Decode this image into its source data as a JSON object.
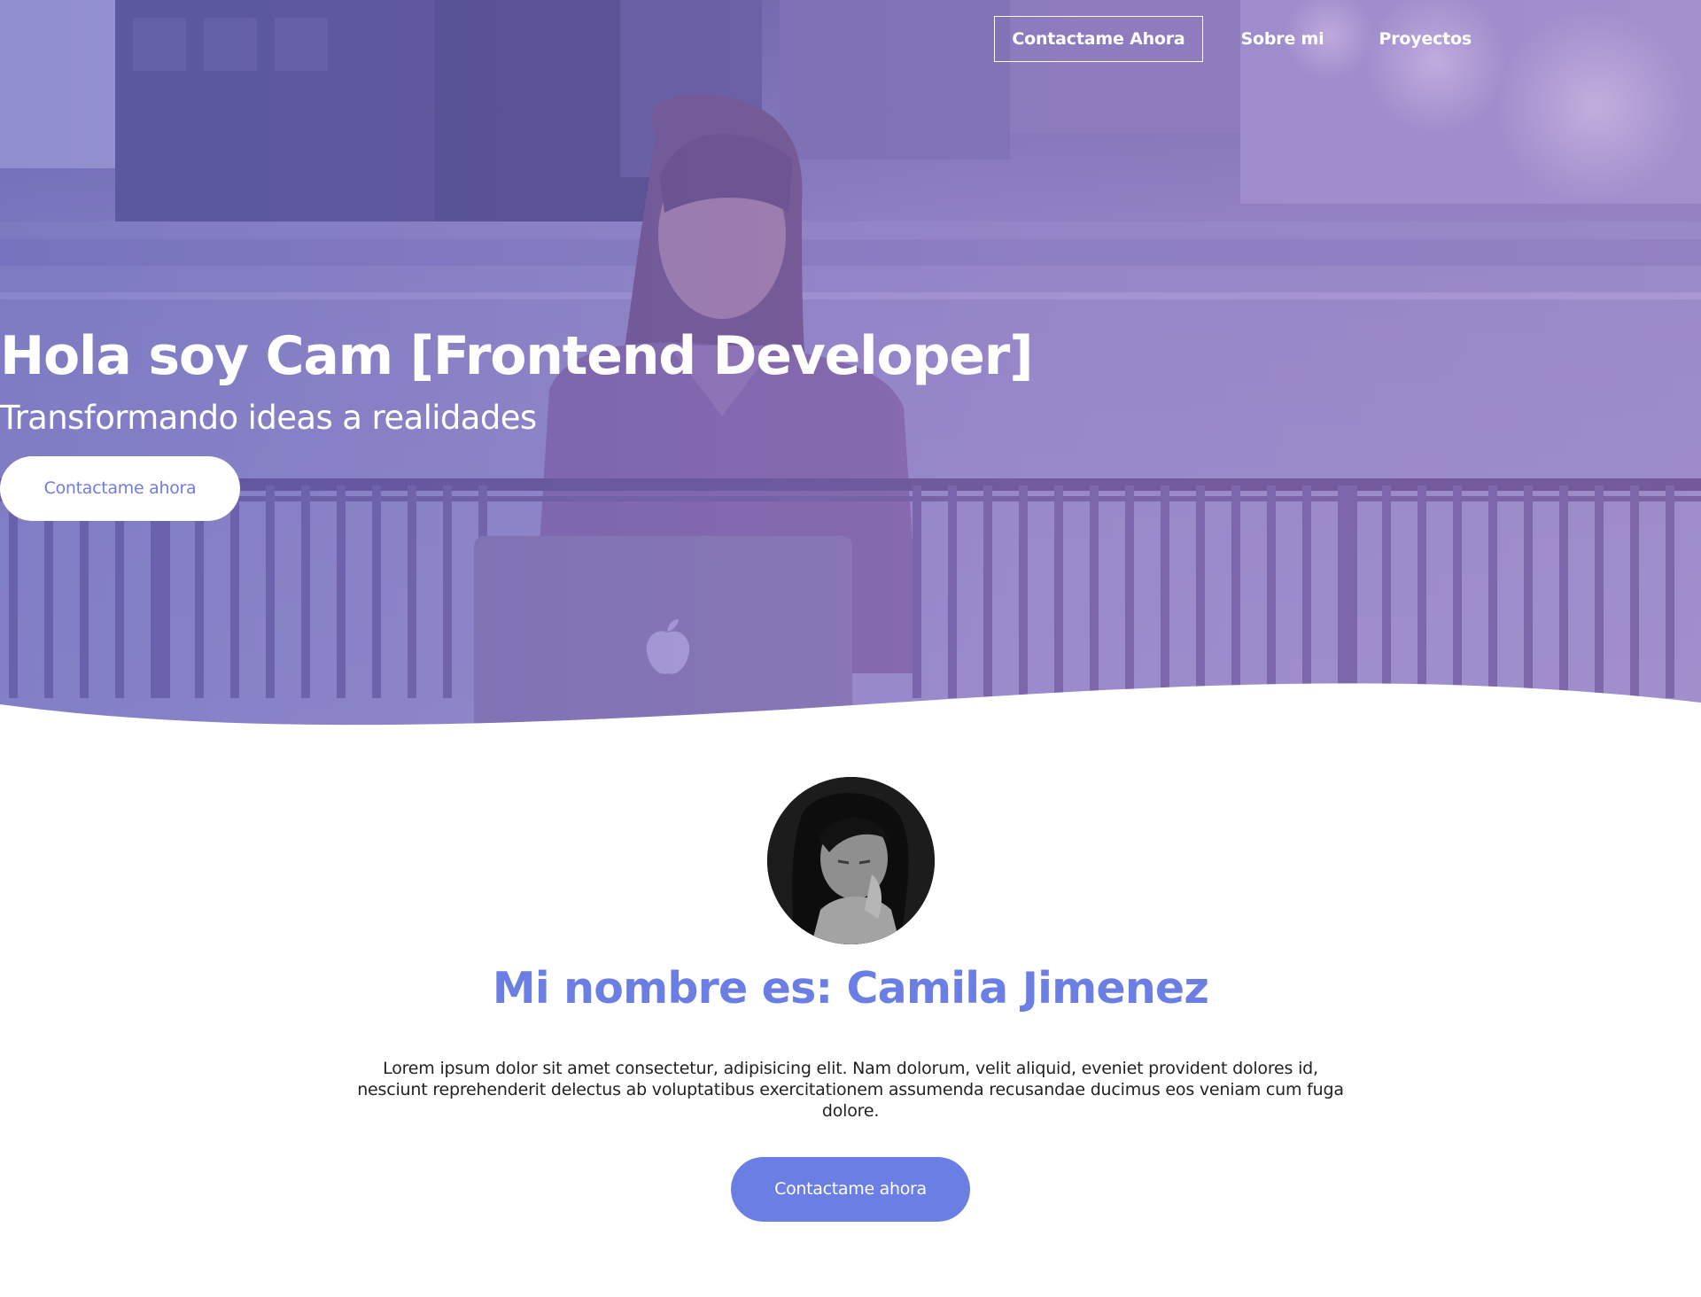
{
  "nav": {
    "items": [
      {
        "label": "Contactame Ahora"
      },
      {
        "label": "Sobre mi"
      },
      {
        "label": "Proyectos"
      }
    ]
  },
  "hero": {
    "title": "Hola soy Cam [Frontend Developer]",
    "subtitle": "Transformando ideas a realidades",
    "cta_label": "Contactame ahora"
  },
  "about": {
    "title": "Mi nombre es: Camila Jimenez",
    "text": "Lorem ipsum dolor sit amet consectetur, adipisicing elit. Nam dolorum, velit aliquid, eveniet provident dolores id, nesciunt reprehenderit delectus ab voluptatibus exercitationem assumenda recusandae ducimus eos veniam cum fuga dolore.",
    "cta_label": "Contactame ahora"
  },
  "colors": {
    "accent": "#6b7ee3",
    "hero_overlay": "#8a78c8",
    "text": "#222222"
  }
}
